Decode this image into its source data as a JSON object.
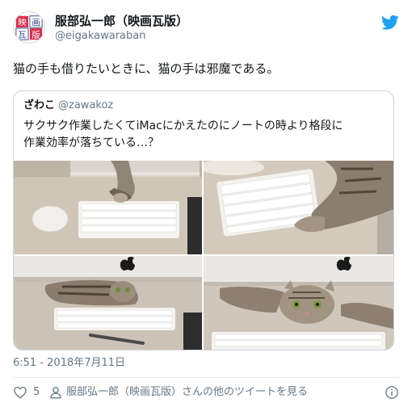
{
  "author": {
    "display_name": "服部弘一郎（映画瓦版）",
    "handle": "@eigakawaraban",
    "avatar_text": [
      "映",
      "画",
      "瓦",
      "版"
    ]
  },
  "tweet": {
    "text": "猫の手も借りたいときに、猫の手は邪魔である。",
    "timestamp": "6:51 - 2018年7月11日"
  },
  "quoted": {
    "name": "ざわこ",
    "handle": "@zawakoz",
    "text_line1": "サクサク作業したくてiMacにかえたのにノートの時より格段に",
    "text_line2": "作業効率が落ちている…？",
    "photo_logo": ""
  },
  "footer": {
    "like_count": "5",
    "more_tweets_label": "服部弘一郎（映画瓦版）さんの他のツイートを見る"
  },
  "icons": {
    "brand": "twitter-bird-icon",
    "like": "heart-icon",
    "profile": "person-icon",
    "info": "info-icon"
  },
  "colors": {
    "twitter_blue": "#1da1f2",
    "text_primary": "#14171a",
    "text_secondary": "#657786",
    "border": "#ccd6dd"
  }
}
